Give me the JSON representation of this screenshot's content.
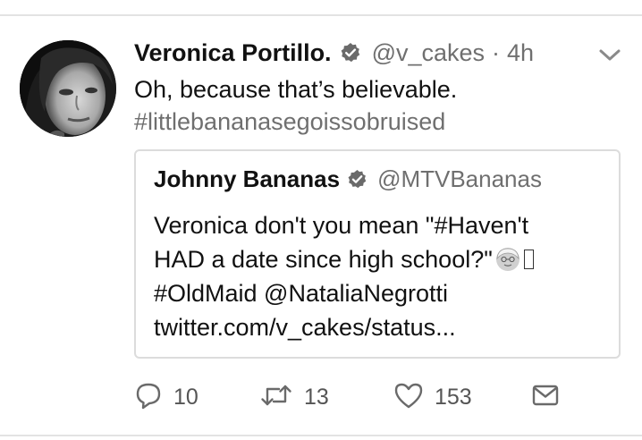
{
  "tweet": {
    "display_name": "Veronica Portillo.",
    "handle": "@v_cakes",
    "separator": "·",
    "time": "4h",
    "text": "Oh, because that’s believable.",
    "hashtag": "#littlebananasegoissobruised"
  },
  "quoted_tweet": {
    "display_name": "Johnny Bananas",
    "handle": "@MTVBananas",
    "line1": "Veronica don't you mean \"#Haven't",
    "line2": "HAD a date since high school?\"",
    "line3": "#OldMaid @NataliaNegrotti",
    "line4": "twitter.com/v_cakes/status..."
  },
  "actions": {
    "reply_count": "10",
    "retweet_count": "13",
    "like_count": "153"
  },
  "icons": {
    "verified": "verified-badge-icon",
    "caret": "chevron-down-icon",
    "reply": "reply-bubble-icon",
    "retweet": "retweet-icon",
    "like": "heart-icon",
    "dm": "envelope-icon",
    "emoji": "older-woman-emoji"
  },
  "colors": {
    "text": "#111111",
    "muted": "#6f6f6f",
    "border": "#dcdcdc",
    "background": "#ffffff"
  }
}
